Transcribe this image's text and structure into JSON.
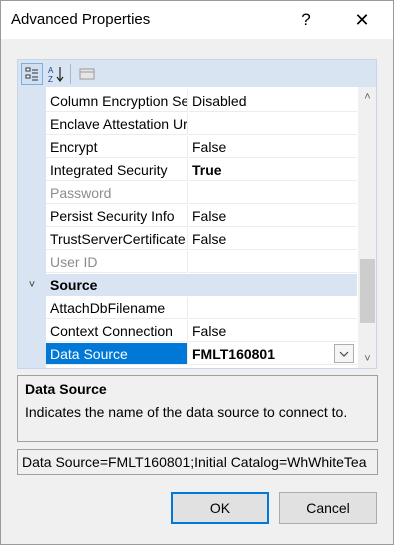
{
  "window": {
    "title": "Advanced Properties",
    "help_glyph": "?",
    "close_glyph": "✕"
  },
  "toolbar": {
    "categorized_icon": "categorized-icon",
    "alphabetical_icon": "alphabetical-sort-icon",
    "property_pages_icon": "property-pages-icon",
    "alpha_text": "A↓Z"
  },
  "grid": {
    "rows": [
      {
        "name": "Column Encryption Setting",
        "value": "Disabled",
        "bold": false,
        "disabled": false
      },
      {
        "name": "Enclave Attestation Url",
        "value": "",
        "bold": false,
        "disabled": false
      },
      {
        "name": "Encrypt",
        "value": "False",
        "bold": false,
        "disabled": false
      },
      {
        "name": "Integrated Security",
        "value": "True",
        "bold": true,
        "disabled": false
      },
      {
        "name": "Password",
        "value": "",
        "bold": false,
        "disabled": true
      },
      {
        "name": "Persist Security Info",
        "value": "False",
        "bold": false,
        "disabled": false
      },
      {
        "name": "TrustServerCertificate",
        "value": "False",
        "bold": false,
        "disabled": false
      },
      {
        "name": "User ID",
        "value": "",
        "bold": false,
        "disabled": true
      }
    ],
    "category": {
      "name": "Source",
      "toggle": "˅"
    },
    "source_rows": [
      {
        "name": "AttachDbFilename",
        "value": ""
      },
      {
        "name": "Context Connection",
        "value": "False"
      },
      {
        "name": "Data Source",
        "value": "FMLT160801"
      }
    ],
    "scroll_up": "˄",
    "scroll_down": "˅"
  },
  "description": {
    "title": "Data Source",
    "text": "Indicates the name of the data source to connect to."
  },
  "connection_string": "Data Source=FMLT160801;Initial Catalog=WhWhiteTea",
  "buttons": {
    "ok": "OK",
    "cancel": "Cancel"
  }
}
